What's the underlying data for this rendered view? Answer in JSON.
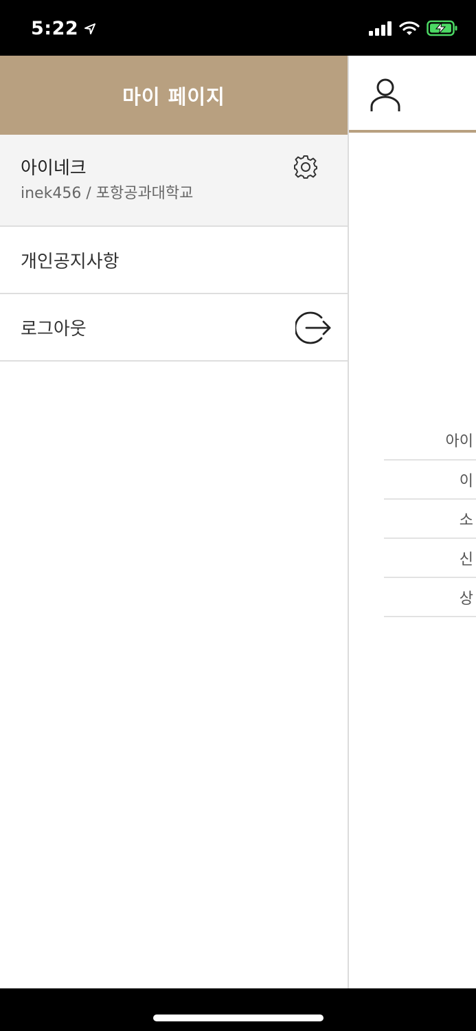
{
  "status_bar": {
    "time": "5:22",
    "icons": [
      "location-arrow-icon",
      "cellular-signal-icon",
      "wifi-icon",
      "battery-charging-icon"
    ]
  },
  "drawer": {
    "title": "마이 페이지",
    "profile": {
      "name": "아이네크",
      "subtitle": "inek456 / 포항공과대학교",
      "settings_icon": "gear-icon"
    },
    "menu_items": [
      {
        "label": "개인공지사항"
      },
      {
        "label": "로그아웃",
        "icon": "logout-icon"
      }
    ],
    "header_color": "#b8a080"
  },
  "main_page": {
    "profile_icon": "user-icon",
    "list_items": [
      {
        "label": "아이"
      },
      {
        "label": "이"
      },
      {
        "label": "소"
      },
      {
        "label": "신"
      },
      {
        "label": "상"
      }
    ]
  }
}
